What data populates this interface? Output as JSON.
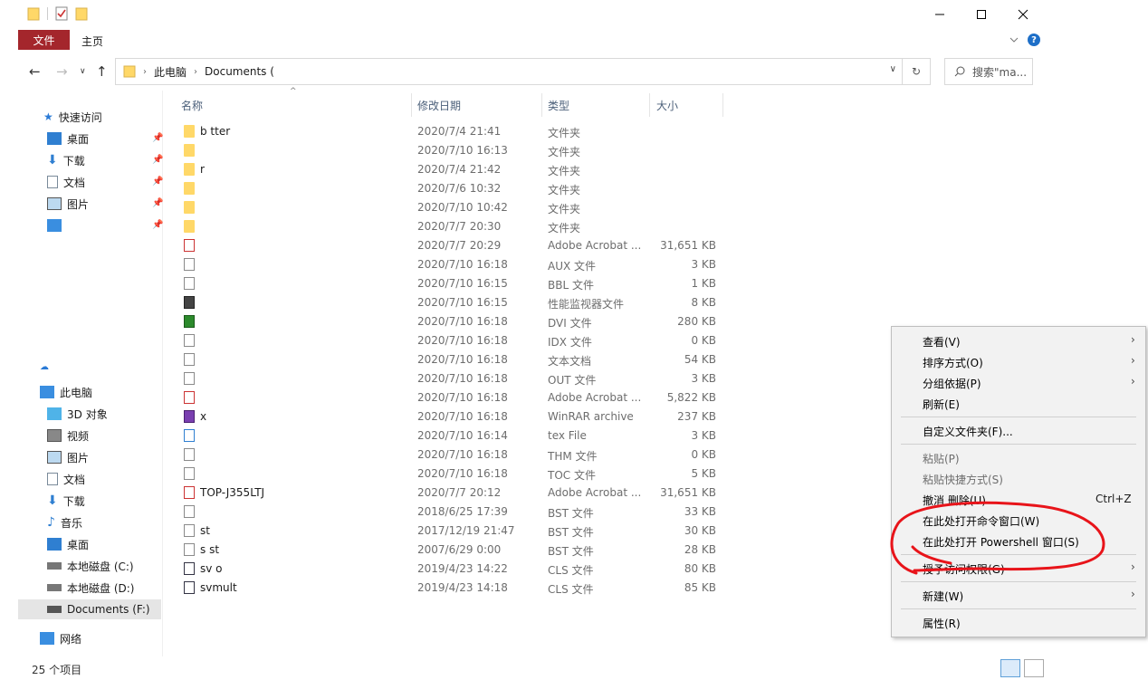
{
  "ribbon": {
    "file_tab": "文件",
    "home_tab": "主页"
  },
  "address": {
    "crumbs": [
      "此电脑",
      "Documents ("
    ]
  },
  "search": {
    "placeholder": "搜索\"ma..."
  },
  "nav": {
    "quick_access": "快速访问",
    "quick_items": [
      "桌面",
      "下载",
      "文档",
      "图片"
    ],
    "this_pc": "此电脑",
    "pc_items": [
      "3D 对象",
      "视频",
      "图片",
      "文档",
      "下载",
      "音乐",
      "桌面",
      "本地磁盘 (C:)",
      "本地磁盘 (D:)",
      "Documents (F:)"
    ],
    "network": "网络"
  },
  "columns": {
    "name": "名称",
    "date": "修改日期",
    "type": "类型",
    "size": "大小"
  },
  "files": [
    {
      "name": "b      tter",
      "date": "2020/7/4 21:41",
      "type": "文件夹",
      "size": "",
      "icon": "folder"
    },
    {
      "name": "",
      "date": "2020/7/10 16:13",
      "type": "文件夹",
      "size": "",
      "icon": "folder"
    },
    {
      "name": "           r",
      "date": "2020/7/4 21:42",
      "type": "文件夹",
      "size": "",
      "icon": "folder"
    },
    {
      "name": "",
      "date": "2020/7/6 10:32",
      "type": "文件夹",
      "size": "",
      "icon": "folder"
    },
    {
      "name": "",
      "date": "2020/7/10 10:42",
      "type": "文件夹",
      "size": "",
      "icon": "folder"
    },
    {
      "name": "",
      "date": "2020/7/7 20:30",
      "type": "文件夹",
      "size": "",
      "icon": "folder"
    },
    {
      "name": "",
      "date": "2020/7/7 20:29",
      "type": "Adobe Acrobat ...",
      "size": "31,651 KB",
      "icon": "pdf"
    },
    {
      "name": "",
      "date": "2020/7/10 16:18",
      "type": "AUX 文件",
      "size": "3 KB",
      "icon": "doc"
    },
    {
      "name": "",
      "date": "2020/7/10 16:15",
      "type": "BBL 文件",
      "size": "1 KB",
      "icon": "doc"
    },
    {
      "name": "",
      "date": "2020/7/10 16:15",
      "type": "性能监视器文件",
      "size": "8 KB",
      "icon": "perf"
    },
    {
      "name": "",
      "date": "2020/7/10 16:18",
      "type": "DVI 文件",
      "size": "280 KB",
      "icon": "dvi"
    },
    {
      "name": "",
      "date": "2020/7/10 16:18",
      "type": "IDX 文件",
      "size": "0 KB",
      "icon": "doc"
    },
    {
      "name": "",
      "date": "2020/7/10 16:18",
      "type": "文本文档",
      "size": "54 KB",
      "icon": "doc"
    },
    {
      "name": "",
      "date": "2020/7/10 16:18",
      "type": "OUT 文件",
      "size": "3 KB",
      "icon": "doc"
    },
    {
      "name": "",
      "date": "2020/7/10 16:18",
      "type": "Adobe Acrobat ...",
      "size": "5,822 KB",
      "icon": "pdf"
    },
    {
      "name": "              x",
      "date": "2020/7/10 16:18",
      "type": "WinRAR archive",
      "size": "237 KB",
      "icon": "rar"
    },
    {
      "name": "",
      "date": "2020/7/10 16:14",
      "type": "tex File",
      "size": "3 KB",
      "icon": "tex"
    },
    {
      "name": "",
      "date": "2020/7/10 16:18",
      "type": "THM 文件",
      "size": "0 KB",
      "icon": "doc"
    },
    {
      "name": "",
      "date": "2020/7/10 16:18",
      "type": "TOC 文件",
      "size": "5 KB",
      "icon": "doc"
    },
    {
      "name": "          TOP-J355LTJ",
      "date": "2020/7/7 20:12",
      "type": "Adobe Acrobat ...",
      "size": "31,651 KB",
      "icon": "pdf"
    },
    {
      "name": "",
      "date": "2018/6/25 17:39",
      "type": "BST 文件",
      "size": "33 KB",
      "icon": "doc"
    },
    {
      "name": "           st",
      "date": "2017/12/19 21:47",
      "type": "BST 文件",
      "size": "30 KB",
      "icon": "doc"
    },
    {
      "name": "s          st",
      "date": "2007/6/29 0:00",
      "type": "BST 文件",
      "size": "28 KB",
      "icon": "doc"
    },
    {
      "name": "sv      o",
      "date": "2019/4/23 14:22",
      "type": "CLS 文件",
      "size": "80 KB",
      "icon": "cls"
    },
    {
      "name": "svmult",
      "date": "2019/4/23 14:18",
      "type": "CLS 文件",
      "size": "85 KB",
      "icon": "cls"
    }
  ],
  "status": {
    "count": "25 个项目"
  },
  "context_menu": {
    "view": "查看(V)",
    "sort": "排序方式(O)",
    "group": "分组依据(P)",
    "refresh": "刷新(E)",
    "customize": "自定义文件夹(F)...",
    "paste": "粘贴(P)",
    "paste_shortcut": "粘贴快捷方式(S)",
    "undo": "撤消 删除(U)",
    "undo_shortcut": "Ctrl+Z",
    "open_cmd": "在此处打开命令窗口(W)",
    "open_ps": "在此处打开 Powershell 窗口(S)",
    "grant": "授予访问权限(G)",
    "new": "新建(W)",
    "properties": "属性(R)"
  },
  "colors": {
    "file_tab": "#a4262c",
    "annotation": "#e8141a",
    "folder": "#ffd868"
  }
}
